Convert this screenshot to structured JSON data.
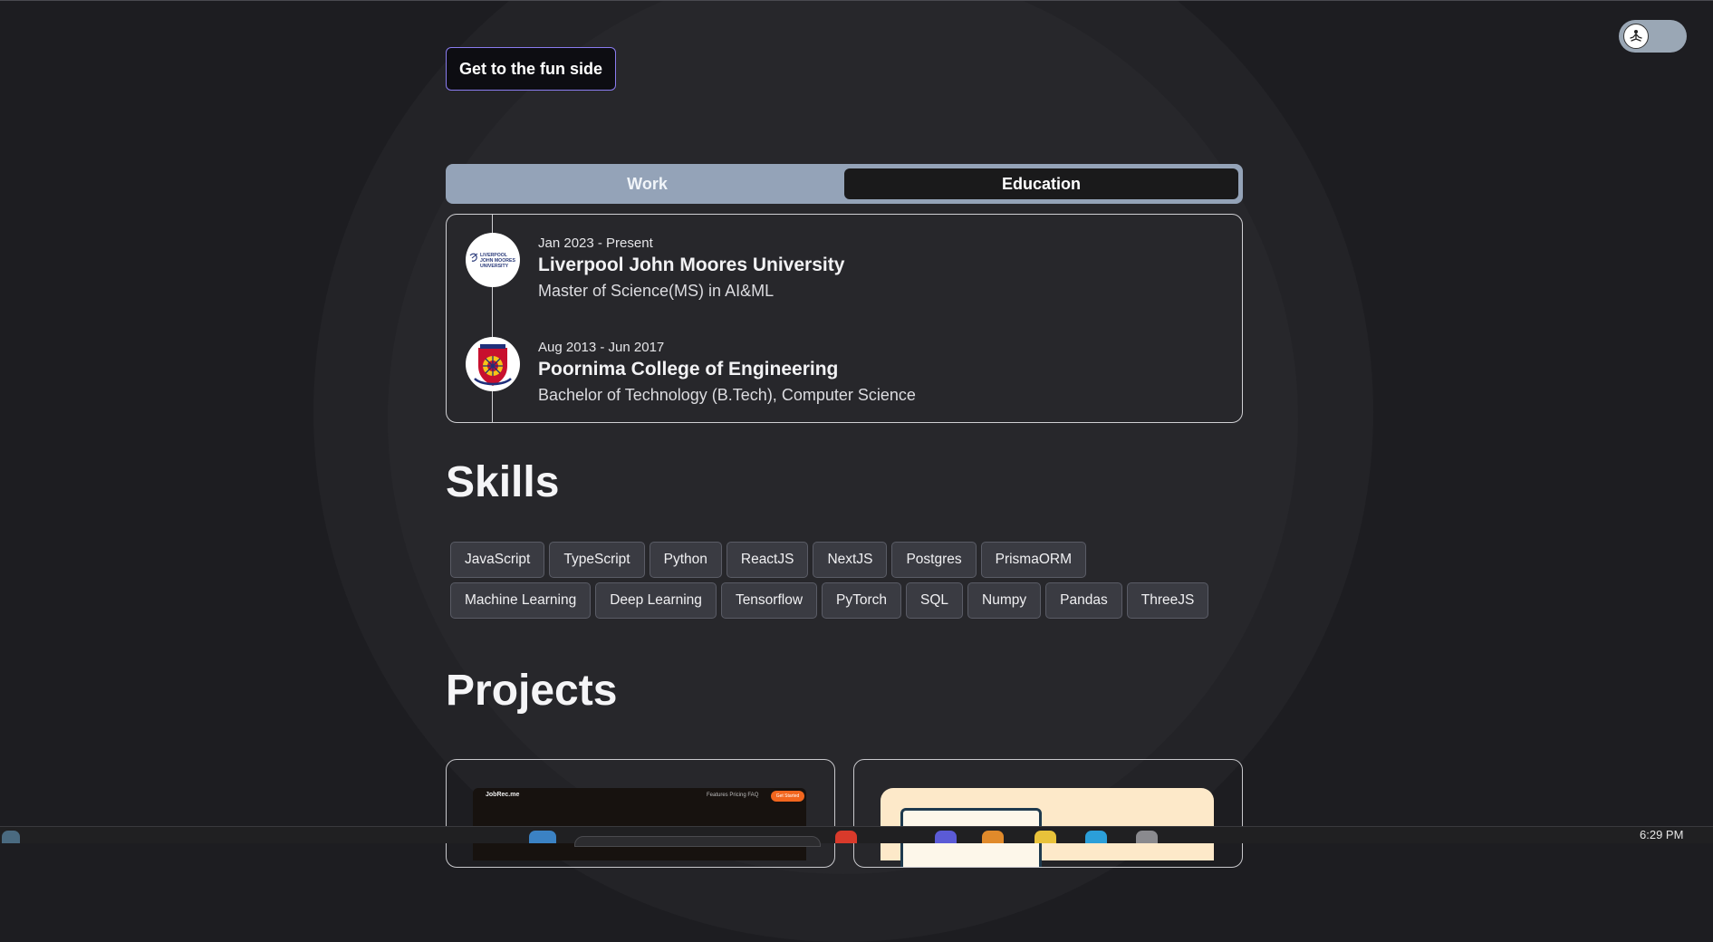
{
  "header": {
    "fun_button_label": "Get to the fun side",
    "theme_toggle": "meditation-icon"
  },
  "tabs": [
    {
      "label": "Work",
      "active": false
    },
    {
      "label": "Education",
      "active": true
    }
  ],
  "education": [
    {
      "date": "Jan 2023 - Present",
      "school": "Liverpool John Moores University",
      "degree": "Master of Science(MS) in AI&ML",
      "logo_text": [
        "LIVERPOOL",
        "JOHN MOORES",
        "UNIVERSITY"
      ]
    },
    {
      "date": "Aug 2013 - Jun 2017",
      "school": "Poornima College of Engineering",
      "degree": "Bachelor of Technology (B.Tech), Computer Science"
    }
  ],
  "skills": {
    "heading": "Skills",
    "items": [
      "JavaScript",
      "TypeScript",
      "Python",
      "ReactJS",
      "NextJS",
      "Postgres",
      "PrismaORM",
      "Machine Learning",
      "Deep Learning",
      "Tensorflow",
      "PyTorch",
      "SQL",
      "Numpy",
      "Pandas",
      "ThreeJS"
    ]
  },
  "projects": {
    "heading": "Projects",
    "cards": [
      {
        "thumb_brand": "JobRec.me",
        "thumb_links": "Features   Pricing   FAQ",
        "thumb_cta": "Get Started"
      },
      {}
    ]
  },
  "taskbar": {
    "clock": "6:29 PM"
  },
  "colors": {
    "background": "#1d1d21",
    "tabs_bg": "#94a3b8",
    "active_tab": "#1a1a1b",
    "skill_chip": "#3a3b42",
    "fun_button_border": "#8a7cf0"
  }
}
